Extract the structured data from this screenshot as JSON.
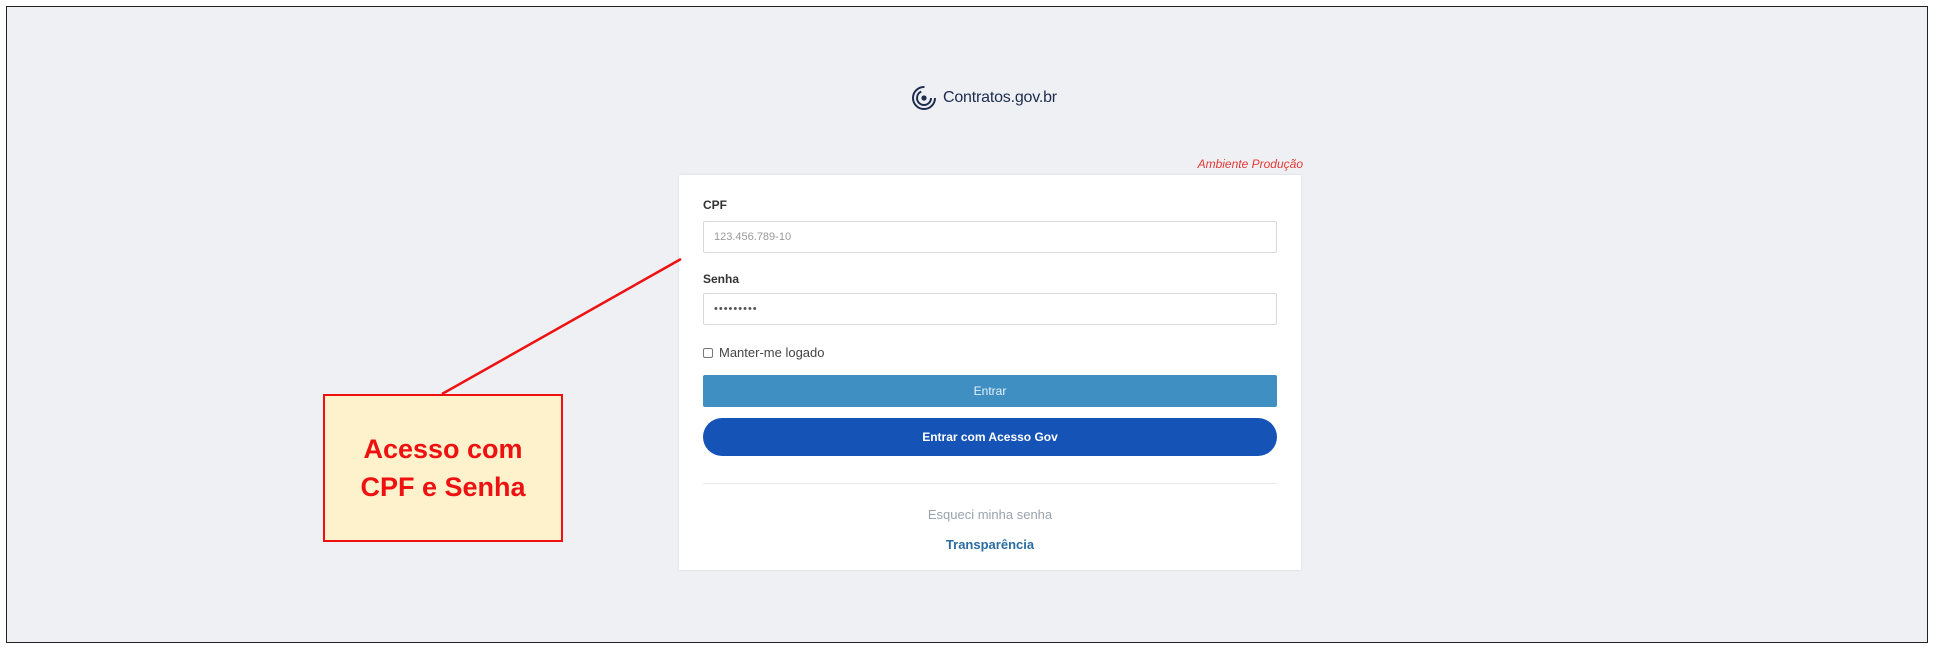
{
  "brand": {
    "name": "Contratos.gov.br",
    "logo_icon": "contratos-swirl-icon",
    "color": "#1d2c4d"
  },
  "environment": {
    "label": "Ambiente Produção",
    "color": "#e53935"
  },
  "form": {
    "cpf_label": "CPF",
    "cpf_placeholder": "123.456.789-10",
    "password_label": "Senha",
    "password_value": "•••••••••",
    "remember_label": "Manter-me logado",
    "remember_checked": false,
    "login_button": "Entrar",
    "gov_login_button": "Entrar com Acesso Gov",
    "forgot_password": "Esqueci minha senha",
    "transparency_link": "Transparência"
  },
  "annotation": {
    "line1": "Acesso com",
    "line2": "CPF e Senha",
    "color": "#ee1111",
    "background": "#fdf2cc"
  },
  "colors": {
    "page_bg": "#eef0f4",
    "login_button": "#3f8fc2",
    "gov_button": "#1553b6"
  }
}
